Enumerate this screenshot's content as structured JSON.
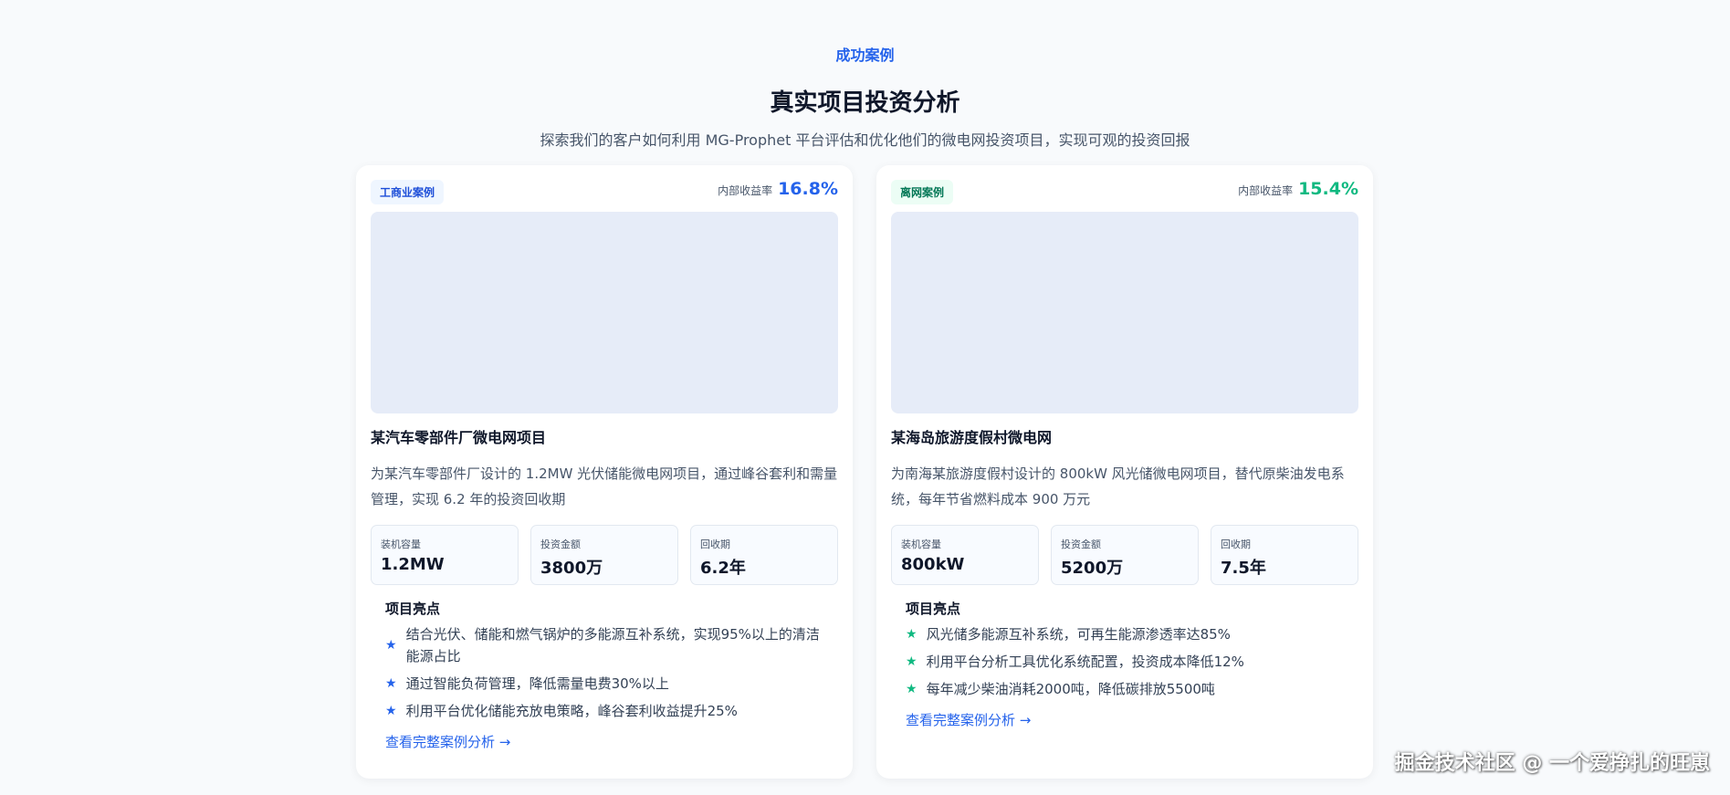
{
  "header": {
    "tag": "成功案例",
    "title": "真实项目投资分析",
    "subtitle": "探索我们的客户如何利用 MG-Prophet 平台评估和优化他们的微电网投资项目，实现可观的投资回报"
  },
  "colors": {
    "accent_blue": "#2563eb",
    "accent_green": "#10b981",
    "image_placeholder": "#e6ecf8"
  },
  "cases": [
    {
      "badge": "工商业案例",
      "irr_label": "内部收益率",
      "irr_value": "16.8%",
      "title": "某汽车零部件厂微电网项目",
      "description": "为某汽车零部件厂设计的 1.2MW 光伏储能微电网项目，通过峰谷套利和需量管理，实现 6.2 年的投资回收期",
      "stats": [
        {
          "label": "装机容量",
          "value": "1.2MW"
        },
        {
          "label": "投资金额",
          "value": "3800万"
        },
        {
          "label": "回收期",
          "value": "6.2年"
        }
      ],
      "highlights_title": "项目亮点",
      "highlights": [
        "结合光伏、储能和燃气锅炉的多能源互补系统，实现95%以上的清洁能源占比",
        "通过智能负荷管理，降低需量电费30%以上",
        "利用平台优化储能充放电策略，峰谷套利收益提升25%"
      ],
      "star_icon": "star-icon",
      "link": "查看完整案例分析 →"
    },
    {
      "badge": "离网案例",
      "irr_label": "内部收益率",
      "irr_value": "15.4%",
      "title": "某海岛旅游度假村微电网",
      "description": "为南海某旅游度假村设计的 800kW 风光储微电网项目，替代原柴油发电系统，每年节省燃料成本 900 万元",
      "stats": [
        {
          "label": "装机容量",
          "value": "800kW"
        },
        {
          "label": "投资金额",
          "value": "5200万"
        },
        {
          "label": "回收期",
          "value": "7.5年"
        }
      ],
      "highlights_title": "项目亮点",
      "highlights": [
        "风光储多能源互补系统，可再生能源渗透率达85%",
        "利用平台分析工具优化系统配置，投资成本降低12%",
        "每年减少柴油消耗2000吨，降低碳排放5500吨"
      ],
      "star_icon": "star-icon",
      "link": "查看完整案例分析 →"
    }
  ],
  "watermark": "掘金技术社区 @ 一个爱挣扎的旺崽"
}
